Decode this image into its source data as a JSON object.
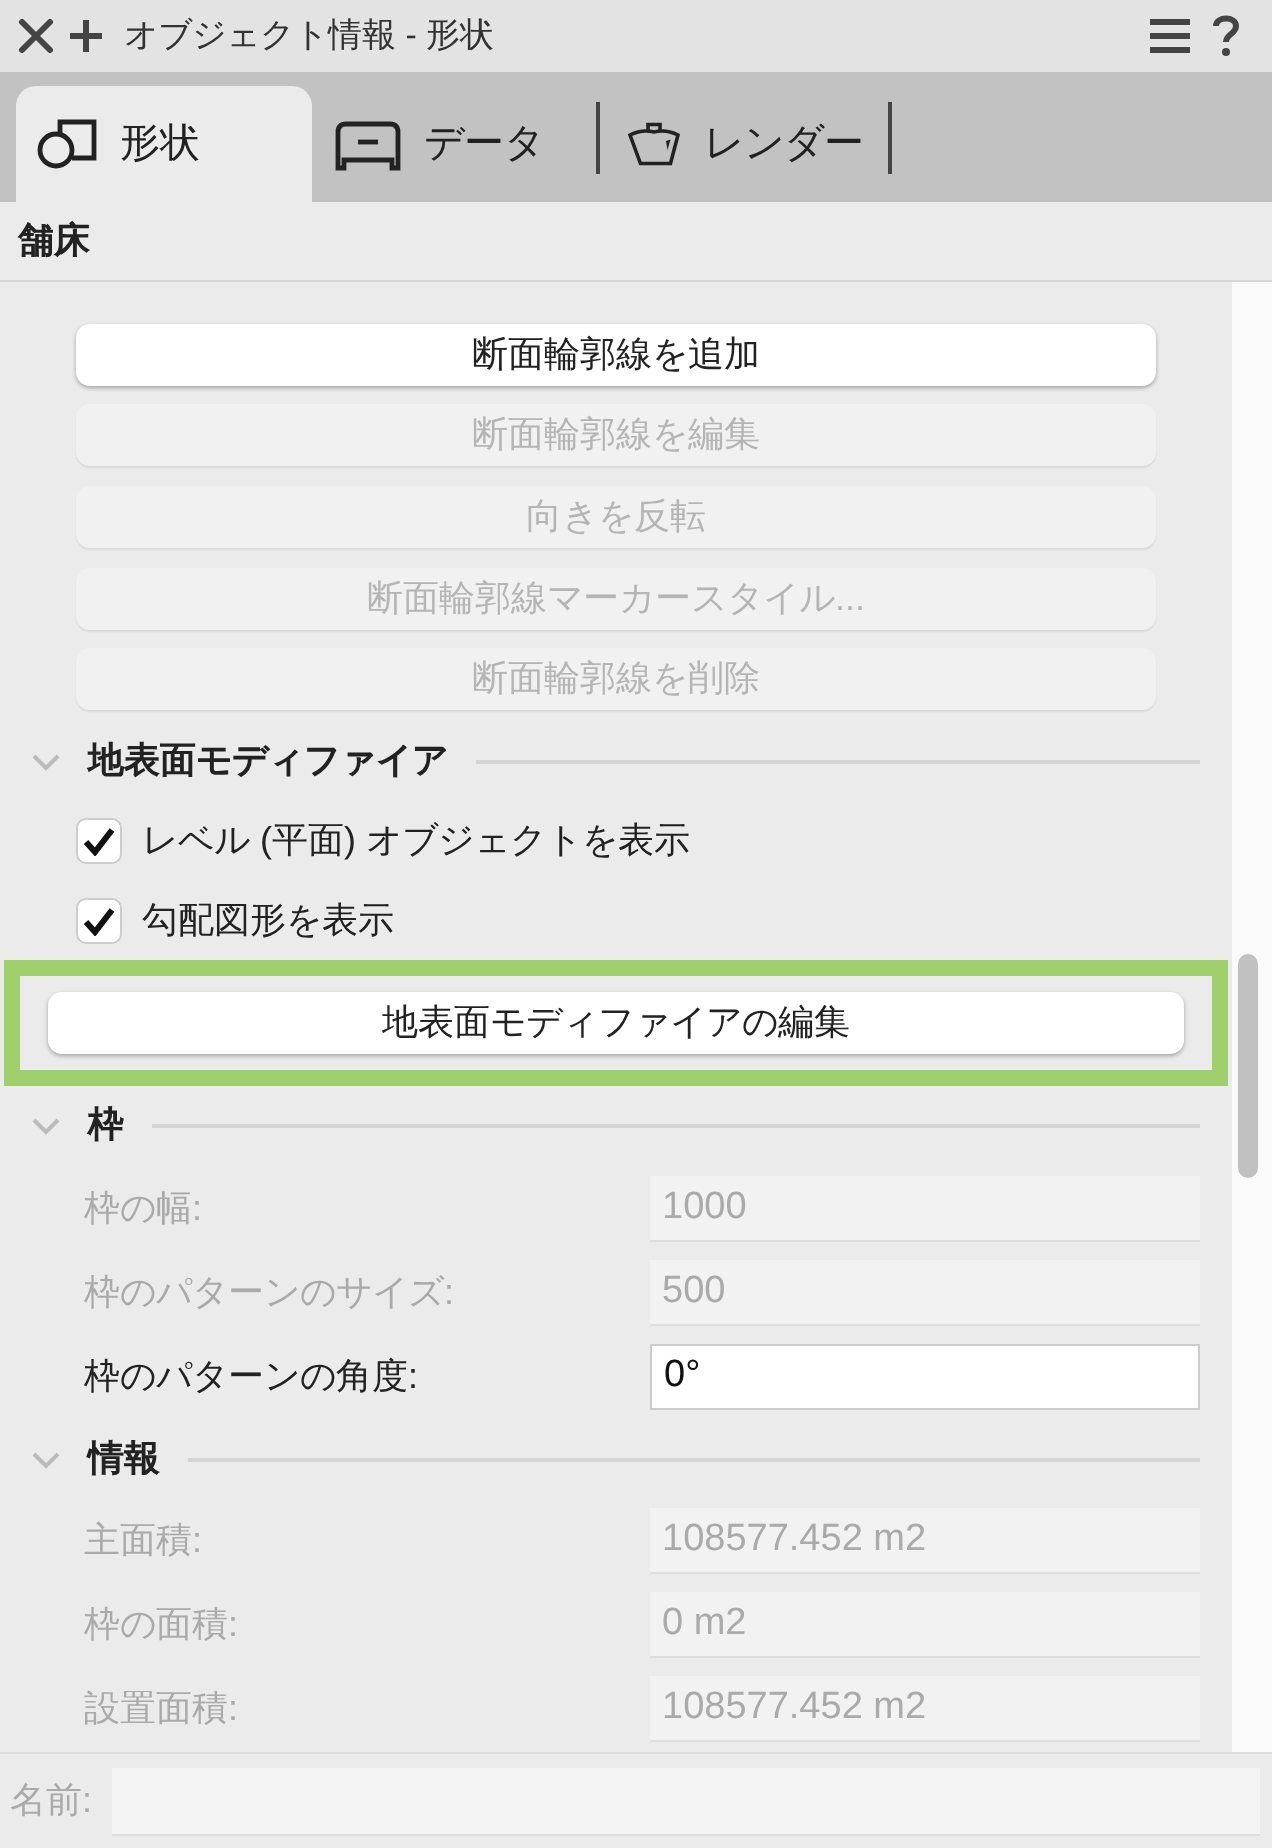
{
  "window": {
    "title": "オブジェクト情報 - 形状"
  },
  "tabs": [
    {
      "label": "形状",
      "selected": true
    },
    {
      "label": "データ",
      "selected": false
    },
    {
      "label": "レンダー",
      "selected": false
    }
  ],
  "object_type": "舗床",
  "items": [
    {
      "kind": "button",
      "label": "断面輪郭線を追加",
      "disabled": false,
      "highlighted": false
    },
    {
      "kind": "button",
      "label": "断面輪郭線を編集",
      "disabled": true,
      "highlighted": false
    },
    {
      "kind": "button",
      "label": "向きを反転",
      "disabled": true,
      "highlighted": false
    },
    {
      "kind": "button",
      "label": "断面輪郭線マーカースタイル...",
      "disabled": true,
      "highlighted": false
    },
    {
      "kind": "button",
      "label": "断面輪郭線を削除",
      "disabled": true,
      "highlighted": false
    },
    {
      "kind": "section",
      "label": "地表面モディファイア",
      "expanded": true
    },
    {
      "kind": "checkbox",
      "label": "レベル (平面) オブジェクトを表示",
      "checked": true
    },
    {
      "kind": "checkbox",
      "label": "勾配図形を表示",
      "checked": true
    },
    {
      "kind": "button",
      "label": "地表面モディファイアの編集",
      "disabled": false,
      "highlighted": true
    },
    {
      "kind": "section",
      "label": "枠",
      "expanded": true
    },
    {
      "kind": "field",
      "label": "枠の幅:",
      "value": "1000",
      "disabled": true
    },
    {
      "kind": "field",
      "label": "枠のパターンのサイズ:",
      "value": "500",
      "disabled": true
    },
    {
      "kind": "field",
      "label": "枠のパターンの角度:",
      "value": "0°",
      "disabled": false
    },
    {
      "kind": "section",
      "label": "情報",
      "expanded": true
    },
    {
      "kind": "field",
      "label": "主面積:",
      "value": "108577.452 m2",
      "disabled": true
    },
    {
      "kind": "field",
      "label": "枠の面積:",
      "value": "0 m2",
      "disabled": true
    },
    {
      "kind": "field",
      "label": "設置面積:",
      "value": "108577.452 m2",
      "disabled": true
    }
  ],
  "name_field": {
    "label": "名前:"
  }
}
